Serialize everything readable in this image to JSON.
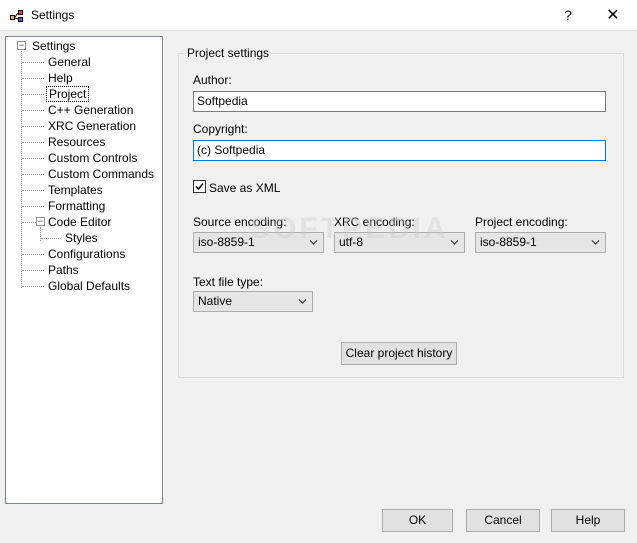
{
  "window": {
    "title": "Settings",
    "help_glyph": "?",
    "close_glyph": "✕"
  },
  "tree": {
    "root": {
      "label": "Settings",
      "expander": "−"
    },
    "items": [
      {
        "label": "General"
      },
      {
        "label": "Help"
      },
      {
        "label": "Project",
        "selected": true
      },
      {
        "label": "C++ Generation"
      },
      {
        "label": "XRC Generation"
      },
      {
        "label": "Resources"
      },
      {
        "label": "Custom Controls"
      },
      {
        "label": "Custom Commands"
      },
      {
        "label": "Templates"
      },
      {
        "label": "Formatting"
      },
      {
        "label": "Code Editor",
        "expander": "−"
      },
      {
        "label": "Styles",
        "child": true
      },
      {
        "label": "Configurations"
      },
      {
        "label": "Paths"
      },
      {
        "label": "Global Defaults"
      }
    ]
  },
  "project_settings": {
    "group_title": "Project settings",
    "author_label": "Author:",
    "author_value": "Softpedia",
    "copyright_label": "Copyright:",
    "copyright_value": "(c) Softpedia",
    "save_as_xml_label": "Save as XML",
    "save_as_xml_checked": true,
    "source_encoding_label": "Source encoding:",
    "source_encoding_value": "iso-8859-1",
    "xrc_encoding_label": "XRC encoding:",
    "xrc_encoding_value": "utf-8",
    "project_encoding_label": "Project encoding:",
    "project_encoding_value": "iso-8859-1",
    "text_file_type_label": "Text file type:",
    "text_file_type_value": "Native",
    "clear_history_label": "Clear project history"
  },
  "footer": {
    "ok_label": "OK",
    "cancel_label": "Cancel",
    "help_label": "Help"
  },
  "watermark": "SOFTPEDIA",
  "colors": {
    "focus_border": "#0078d7",
    "background": "#f0f0f0"
  }
}
